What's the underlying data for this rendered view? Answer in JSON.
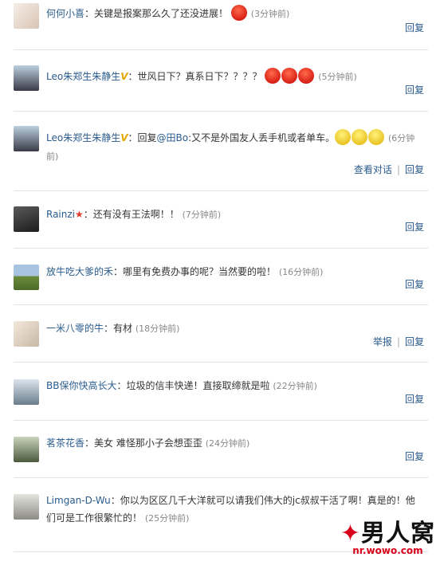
{
  "comments": [
    {
      "user": "何何小喜",
      "text": "关键是报案那么久了还没进展！",
      "emojis": [
        "angry"
      ],
      "time": "(3分钟前)",
      "actions": [
        "回复"
      ]
    },
    {
      "user": "Leo朱郑生朱静生",
      "verified": "V",
      "text": "世风日下？真系日下？？？？",
      "emojis": [
        "angry",
        "angry",
        "angry"
      ],
      "time": "(5分钟前)",
      "actions": [
        "回复"
      ]
    },
    {
      "user": "Leo朱郑生朱静生",
      "verified": "V",
      "text_prefix": "回复",
      "mention": "@田Bo",
      "text": ":又不是外国友人丢手机或者单车。",
      "emojis": [
        "grin",
        "grin",
        "grin"
      ],
      "time": "(6分钟前)",
      "actions": [
        "查看对话",
        "回复"
      ]
    },
    {
      "user": "Rainzi",
      "star": "★",
      "text": "还有没有王法啊！！",
      "time": "(7分钟前)",
      "actions": [
        "回复"
      ]
    },
    {
      "user": "放牛吃大爹的禾",
      "text": "哪里有免费办事的呢？当然要的啦！",
      "time": "(16分钟前)",
      "actions": [
        "回复"
      ]
    },
    {
      "user": "一米八零的牛",
      "text": "有材",
      "time": "(18分钟前)",
      "actions": [
        "举报",
        "回复"
      ]
    },
    {
      "user": "BB保你快高长大",
      "text": "垃圾的信丰快递！直接取缔就是啦",
      "time": "(22分钟前)",
      "actions": [
        "回复"
      ]
    },
    {
      "user": "茗茶花香",
      "text": "美女 难怪那小子会想歪歪",
      "time": "(24分钟前)",
      "actions": [
        "回复"
      ]
    },
    {
      "user": "Limgan-D-Wu",
      "text": "你以为区区几千大洋就可以请我们伟大的jc叔叔干活了啊！真是的！他们可是工作很繁忙的！",
      "time": "(25分钟前)",
      "actions": []
    }
  ],
  "watermark": {
    "logo": "男人窝",
    "url": "nr.wowo.com"
  },
  "colors": {
    "link": "#2a5b8c",
    "time": "#888888",
    "divider": "#e4e4e4",
    "brand_red": "#d8001a"
  }
}
